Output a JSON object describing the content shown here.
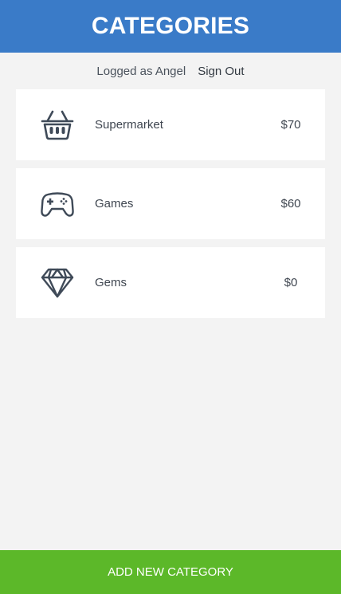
{
  "header": {
    "title": "CATEGORIES"
  },
  "session": {
    "user_text": "Logged as Angel",
    "sign_out_label": "Sign Out"
  },
  "categories": [
    {
      "icon": "basket-icon",
      "name": "Supermarket",
      "amount": "$70"
    },
    {
      "icon": "gamepad-icon",
      "name": "Games",
      "amount": "$60"
    },
    {
      "icon": "diamond-icon",
      "name": "Gems",
      "amount": "$0"
    }
  ],
  "footer": {
    "add_label": "ADD NEW CATEGORY"
  },
  "colors": {
    "header_bg": "#3a7bc8",
    "footer_bg": "#5cb829",
    "page_bg": "#f3f3f3",
    "icon_stroke": "#3f4a58"
  }
}
